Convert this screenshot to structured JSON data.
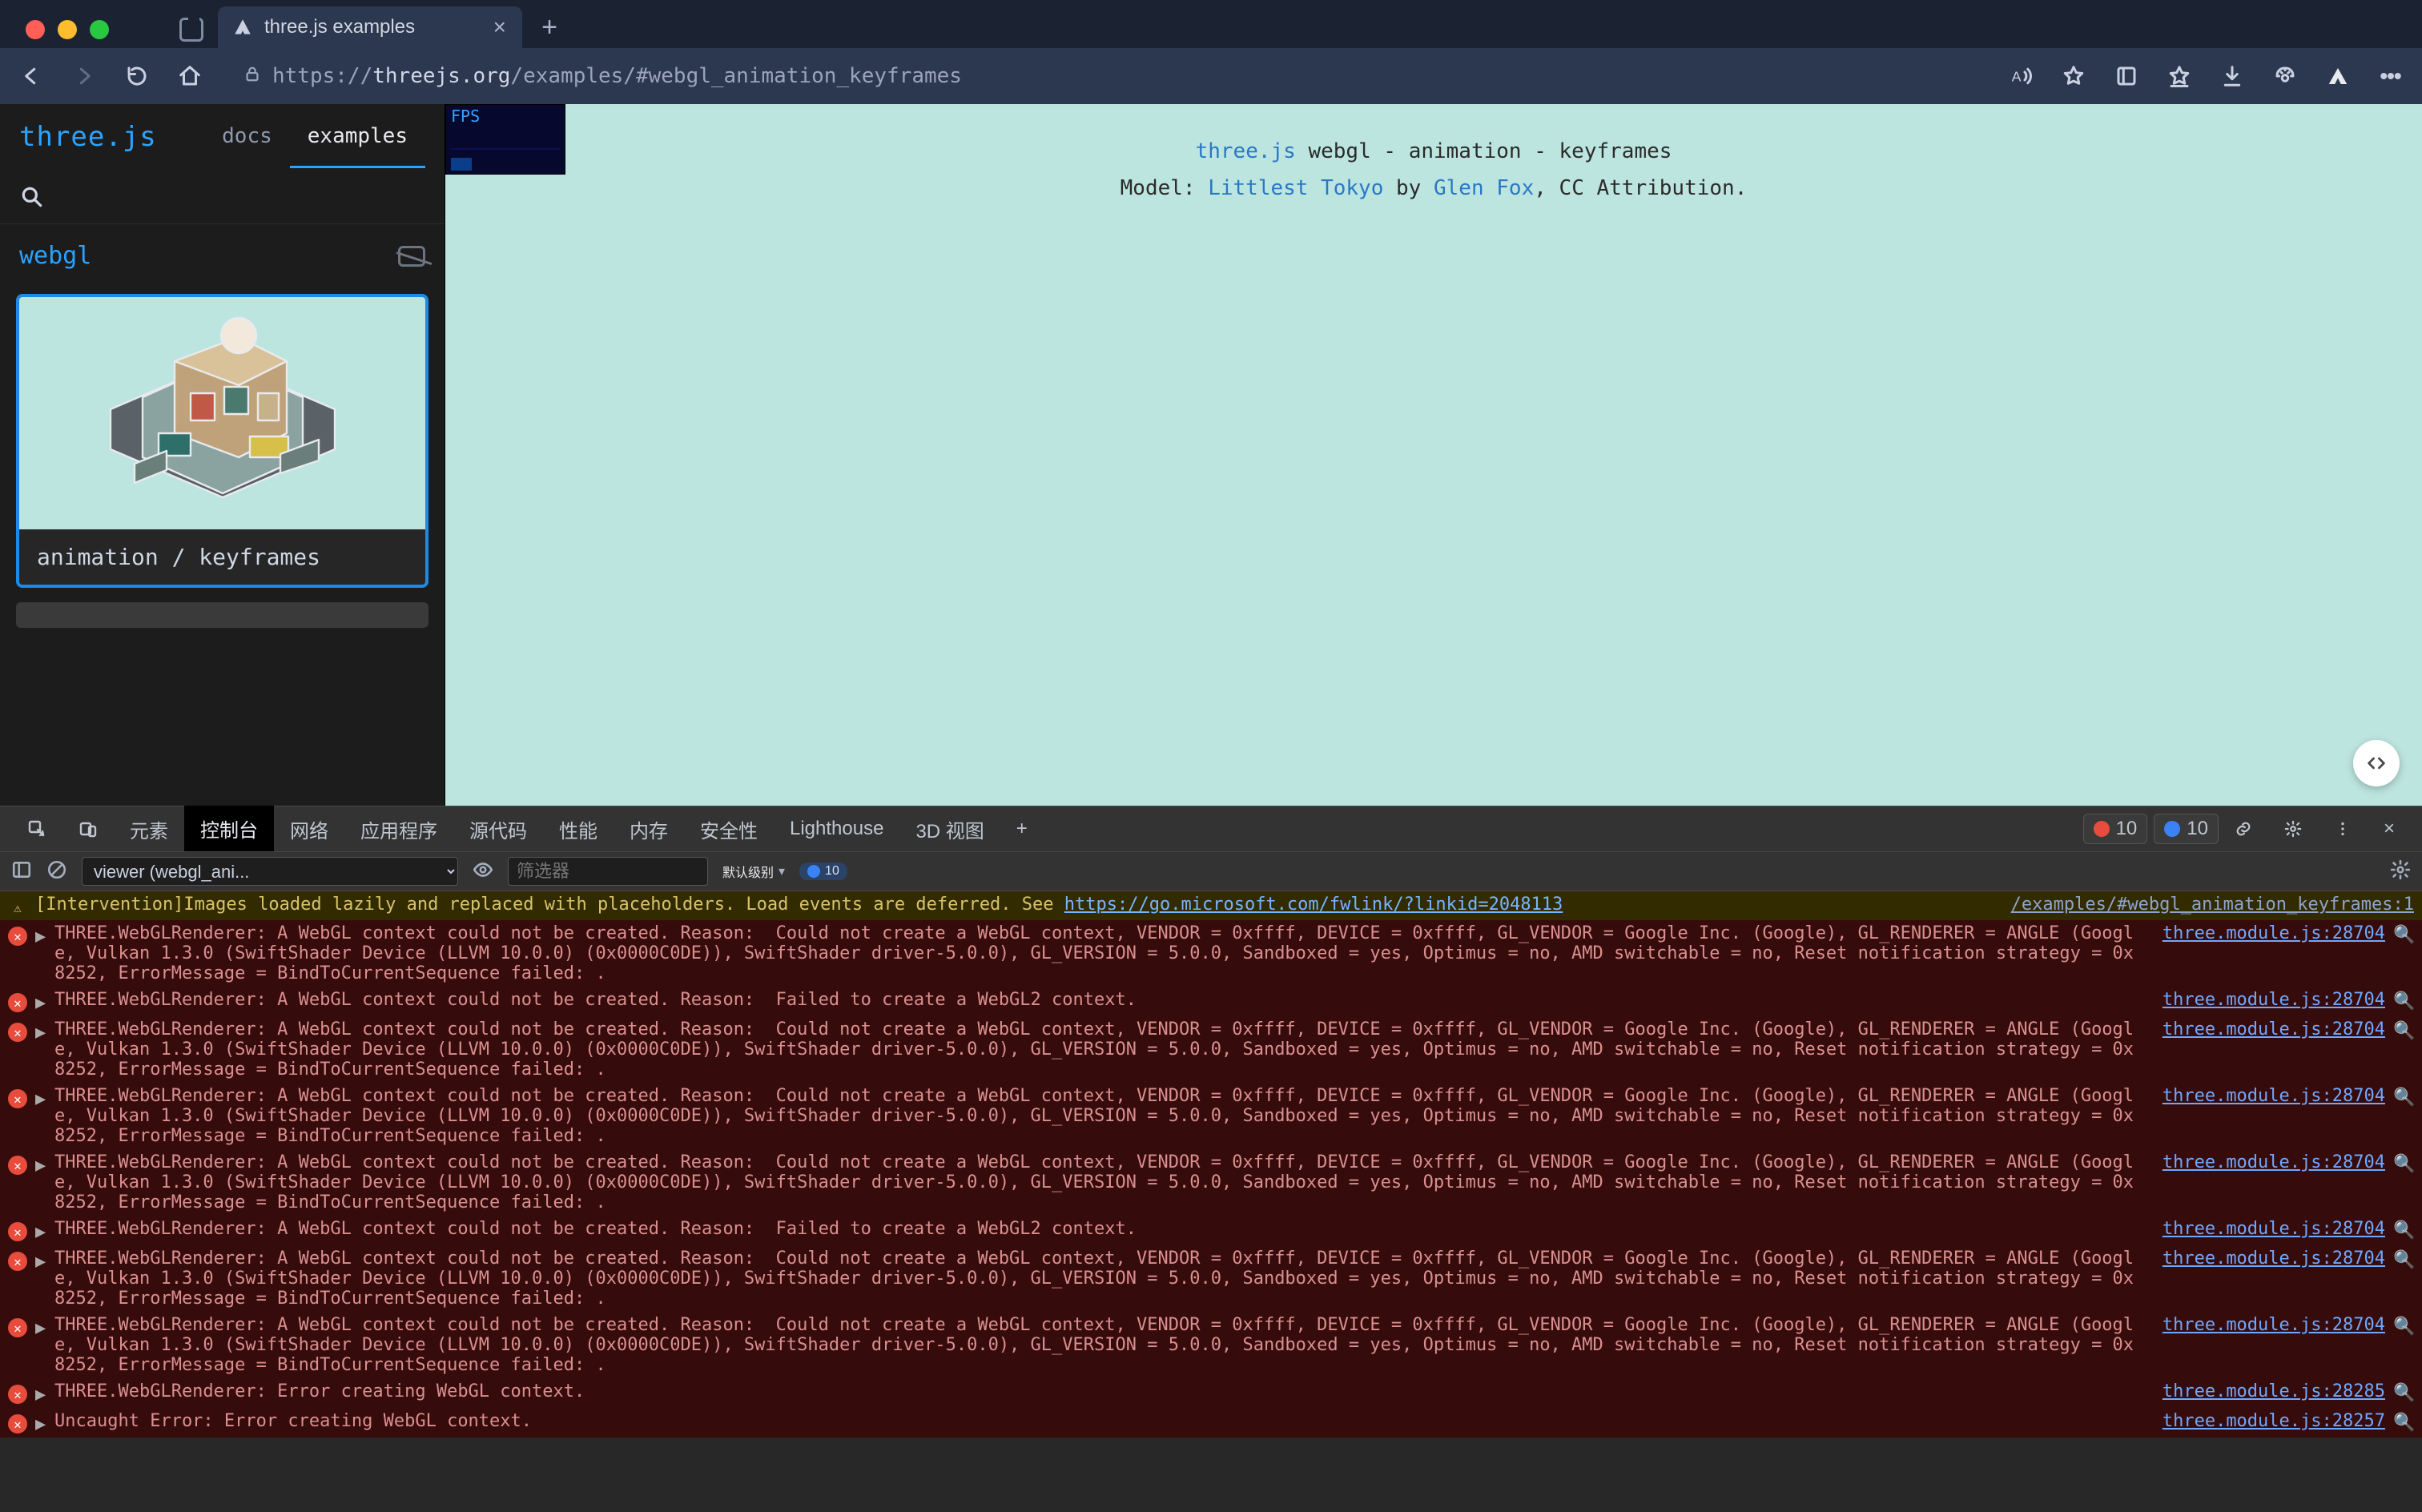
{
  "browser": {
    "tab_title": "three.js examples",
    "url_prefix": "https://",
    "url_host": "threejs.org",
    "url_path": "/examples/#webgl_animation_keyframes"
  },
  "sidebar": {
    "logo": "three.js",
    "nav": {
      "docs": "docs",
      "examples": "examples"
    },
    "section": "webgl",
    "card_caption": "animation / keyframes"
  },
  "fps_label": "FPS",
  "page": {
    "line1_link": "three.js",
    "line1_rest": " webgl - animation - keyframes",
    "line2_pre": "Model: ",
    "line2_model": "Littlest Tokyo",
    "line2_by": " by ",
    "line2_author": "Glen Fox",
    "line2_tail": ", CC Attribution."
  },
  "devtools": {
    "tabs": [
      "元素",
      "控制台",
      "网络",
      "应用程序",
      "源代码",
      "性能",
      "内存",
      "安全性",
      "Lighthouse",
      "3D 视图"
    ],
    "active_tab": 1,
    "counts": {
      "errors": "10",
      "issues": "10"
    },
    "context": "viewer (webgl_ani...",
    "filter_placeholder": "筛选器",
    "level_label": "默认级别",
    "issue_pill": "10"
  },
  "console": {
    "warn": {
      "msg": "[Intervention]Images loaded lazily and replaced with placeholders. Load events are deferred. See ",
      "link": "https://go.microsoft.com/fwlink/?linkid=2048113",
      "src": "/examples/#webgl_animation_keyframes:1"
    },
    "errLong": "THREE.WebGLRenderer: A WebGL context could not be created. Reason:  Could not create a WebGL context, VENDOR = 0xffff, DEVICE = 0xffff, GL_VENDOR = Google Inc. (Google), GL_RENDERER = ANGLE (Google, Vulkan 1.3.0 (SwiftShader Device (LLVM 10.0.0) (0x0000C0DE)), SwiftShader driver-5.0.0), GL_VERSION = 5.0.0, Sandboxed = yes, Optimus = no, AMD switchable = no, Reset notification strategy = 0x8252, ErrorMessage = BindToCurrentSequence failed: .",
    "errShort": "THREE.WebGLRenderer: A WebGL context could not be created. Reason:  Failed to create a WebGL2 context.",
    "errCreate": "THREE.WebGLRenderer: Error creating WebGL context.",
    "errUncaught": "Uncaught Error: Error creating WebGL context.",
    "src_main": "three.module.js:28704",
    "src_28285": "three.module.js:28285",
    "src_28257": "three.module.js:28257"
  }
}
